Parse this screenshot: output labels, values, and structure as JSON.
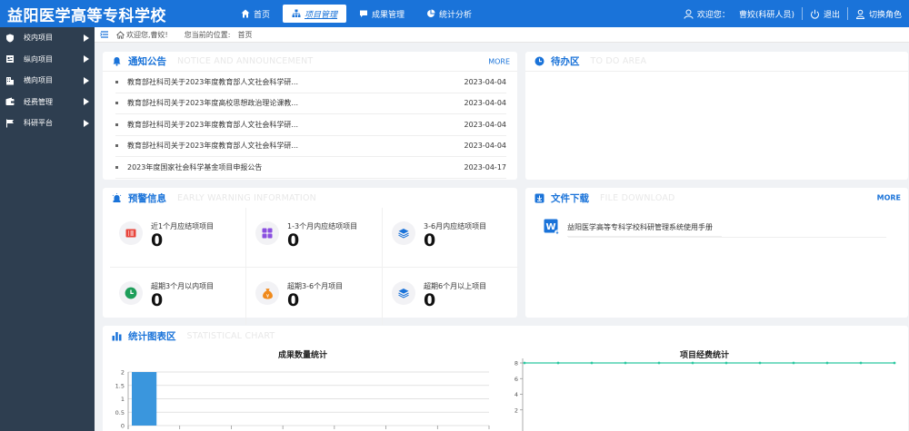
{
  "header": {
    "brand": "益阳医学高等专科学校",
    "nav": [
      {
        "label": "首页",
        "icon": "home-icon",
        "active": false
      },
      {
        "label": "项目管理",
        "icon": "org-chart-icon",
        "active": true
      },
      {
        "label": "成果管理",
        "icon": "chat-bubble-icon",
        "active": false
      },
      {
        "label": "统计分析",
        "icon": "pie-chart-icon",
        "active": false
      }
    ],
    "user_greeting": "欢迎您：",
    "user_name": "曹姣(科研人员)",
    "logout": "退出",
    "switch_role": "切换角色"
  },
  "sidebar": {
    "items": [
      {
        "label": "校内项目",
        "icon": "shield-icon"
      },
      {
        "label": "纵向项目",
        "icon": "calendar-book-icon"
      },
      {
        "label": "横向项目",
        "icon": "building-icon"
      },
      {
        "label": "经费管理",
        "icon": "wallet-icon"
      },
      {
        "label": "科研平台",
        "icon": "flag-icon"
      }
    ]
  },
  "breadcrumb": {
    "welcome": "欢迎您,曹姣!",
    "location_label": "您当前的位置:",
    "current": "首页"
  },
  "notice": {
    "title": "通知公告",
    "title_en": "NOTICE AND ANNOUNCEMENT",
    "more": "MORE",
    "items": [
      {
        "title": "教育部社科司关于2023年度教育部人文社会科学研...",
        "date": "2023-04-04"
      },
      {
        "title": "教育部社科司关于2023年度高校思想政治理论课教...",
        "date": "2023-04-04"
      },
      {
        "title": "教育部社科司关于2023年度教育部人文社会科学研...",
        "date": "2023-04-04"
      },
      {
        "title": "教育部社科司关于2023年度教育部人文社会科学研...",
        "date": "2023-04-04"
      },
      {
        "title": "2023年度国家社会科学基金项目申报公告",
        "date": "2023-04-17"
      }
    ]
  },
  "todo": {
    "title": "待办区",
    "title_en": "TO DO AREA"
  },
  "warning": {
    "title": "预警信息",
    "title_en": "EARLY WARNING INFORMATION",
    "items": [
      {
        "label": "近1个月应结项项目",
        "value": "0",
        "icon": "list-icon",
        "color": "#e8453c"
      },
      {
        "label": "1-3个月内应结项项目",
        "value": "0",
        "icon": "grid-icon",
        "color": "#8a4fe0"
      },
      {
        "label": "3-6月内应结项项目",
        "value": "0",
        "icon": "layers-icon",
        "color": "#1a73d9"
      },
      {
        "label": "超期3个月以内项目",
        "value": "0",
        "icon": "clock-icon",
        "color": "#1e9e5a"
      },
      {
        "label": "超期3-6个月项目",
        "value": "0",
        "icon": "money-bag-icon",
        "color": "#f08a1c"
      },
      {
        "label": "超期6个月以上项目",
        "value": "0",
        "icon": "layers-icon",
        "color": "#1a73d9"
      }
    ]
  },
  "download": {
    "title": "文件下载",
    "title_en": "FILE DOWNLOAD",
    "more": "MORE",
    "files": [
      {
        "name": "益阳医学高等专科学校科研管理系统使用手册",
        "icon": "word-doc-icon"
      }
    ]
  },
  "stats": {
    "title": "统计图表区",
    "title_en": "STATISTICAL CHART"
  },
  "chart_data": [
    {
      "type": "bar",
      "title": "成果数量统计",
      "categories": [
        "",
        "",
        "",
        "",
        "",
        "",
        ""
      ],
      "values": [
        2,
        0,
        0,
        0,
        0,
        0,
        0
      ],
      "ylim": [
        0,
        2
      ],
      "yticks": [
        "0",
        "0.5",
        "1",
        "1.5",
        "2"
      ],
      "color": "#3a96dd",
      "grid": true
    },
    {
      "type": "line",
      "title": "项目经费统计",
      "x": [
        "",
        "",
        "",
        "",
        "",
        "",
        "",
        "",
        "",
        "",
        "",
        ""
      ],
      "values": [
        8,
        8,
        8,
        8,
        8,
        8,
        8,
        8,
        8,
        8,
        8,
        8
      ],
      "ylim": [
        0,
        8
      ],
      "yticks": [
        "2",
        "4",
        "6",
        "8"
      ],
      "color": "#2bc8a0",
      "grid": false
    }
  ]
}
